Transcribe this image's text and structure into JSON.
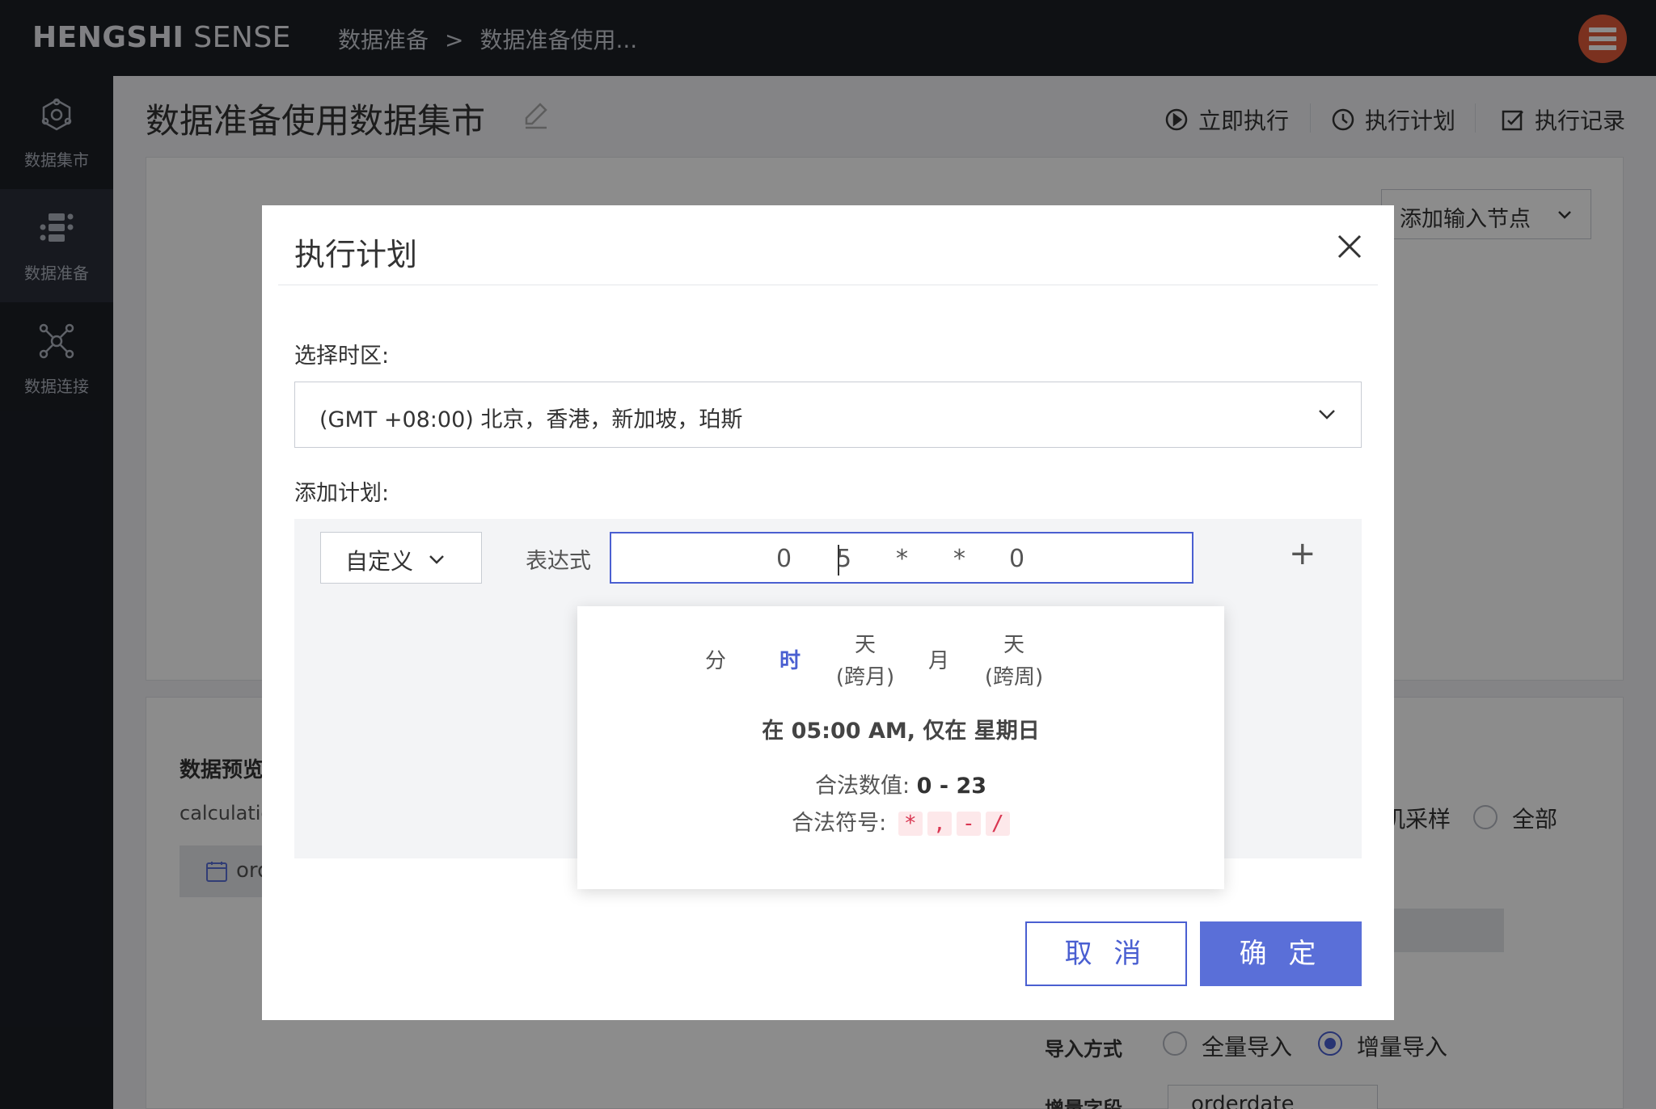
{
  "app": {
    "logo_bold": "HENGSHI",
    "logo_light": " SENSE"
  },
  "breadcrumb": {
    "item1": "数据准备",
    "separator": ">",
    "item2": "数据准备使用..."
  },
  "sidebar": {
    "items": [
      {
        "label": "数据集市",
        "icon": "dataset-icon",
        "active": false
      },
      {
        "label": "数据准备",
        "icon": "data-prep-icon",
        "active": true
      },
      {
        "label": "数据连接",
        "icon": "connection-icon",
        "active": false
      }
    ]
  },
  "page": {
    "title": "数据准备使用数据集市",
    "actions": {
      "run_now": "立即执行",
      "schedule": "执行计划",
      "history": "执行记录"
    },
    "add_node": "添加输入节点"
  },
  "preview": {
    "title": "数据预览",
    "calc": "calculatio",
    "field": "ord",
    "sample_label": "机采样",
    "all_label": "全部",
    "import_label": "导入方式",
    "import_full": "全量导入",
    "import_incremental": "增量导入",
    "incremental_field_label": "增量字段",
    "incremental_field_value": "orderdate"
  },
  "modal": {
    "title": "执行计划",
    "timezone_label": "选择时区:",
    "timezone_value": "(GMT +08:00) 北京，香港，新加坡，珀斯",
    "plan_label": "添加计划:",
    "mode_value": "自定义",
    "expr_label": "表达式",
    "expr_tokens": [
      "0",
      "5",
      "*",
      "*",
      "0"
    ],
    "add_symbol": "+",
    "popup": {
      "tabs": [
        {
          "line1": "分",
          "line2": ""
        },
        {
          "line1": "时",
          "line2": ""
        },
        {
          "line1": "天",
          "line2": "(跨月)"
        },
        {
          "line1": "月",
          "line2": ""
        },
        {
          "line1": "天",
          "line2": "(跨周)"
        }
      ],
      "active_tab_index": 1,
      "description": "在 05:00 AM, 仅在 星期日",
      "valid_values_label": "合法数值:",
      "valid_values": "0 - 23",
      "valid_symbols_label": "合法符号:",
      "valid_symbols": [
        "*",
        ",",
        "-",
        "/"
      ]
    },
    "cancel": "取 消",
    "confirm": "确 定"
  },
  "colors": {
    "accent": "#4a5fd1",
    "topbar": "#1c1f26",
    "chip_text": "#d93651"
  }
}
